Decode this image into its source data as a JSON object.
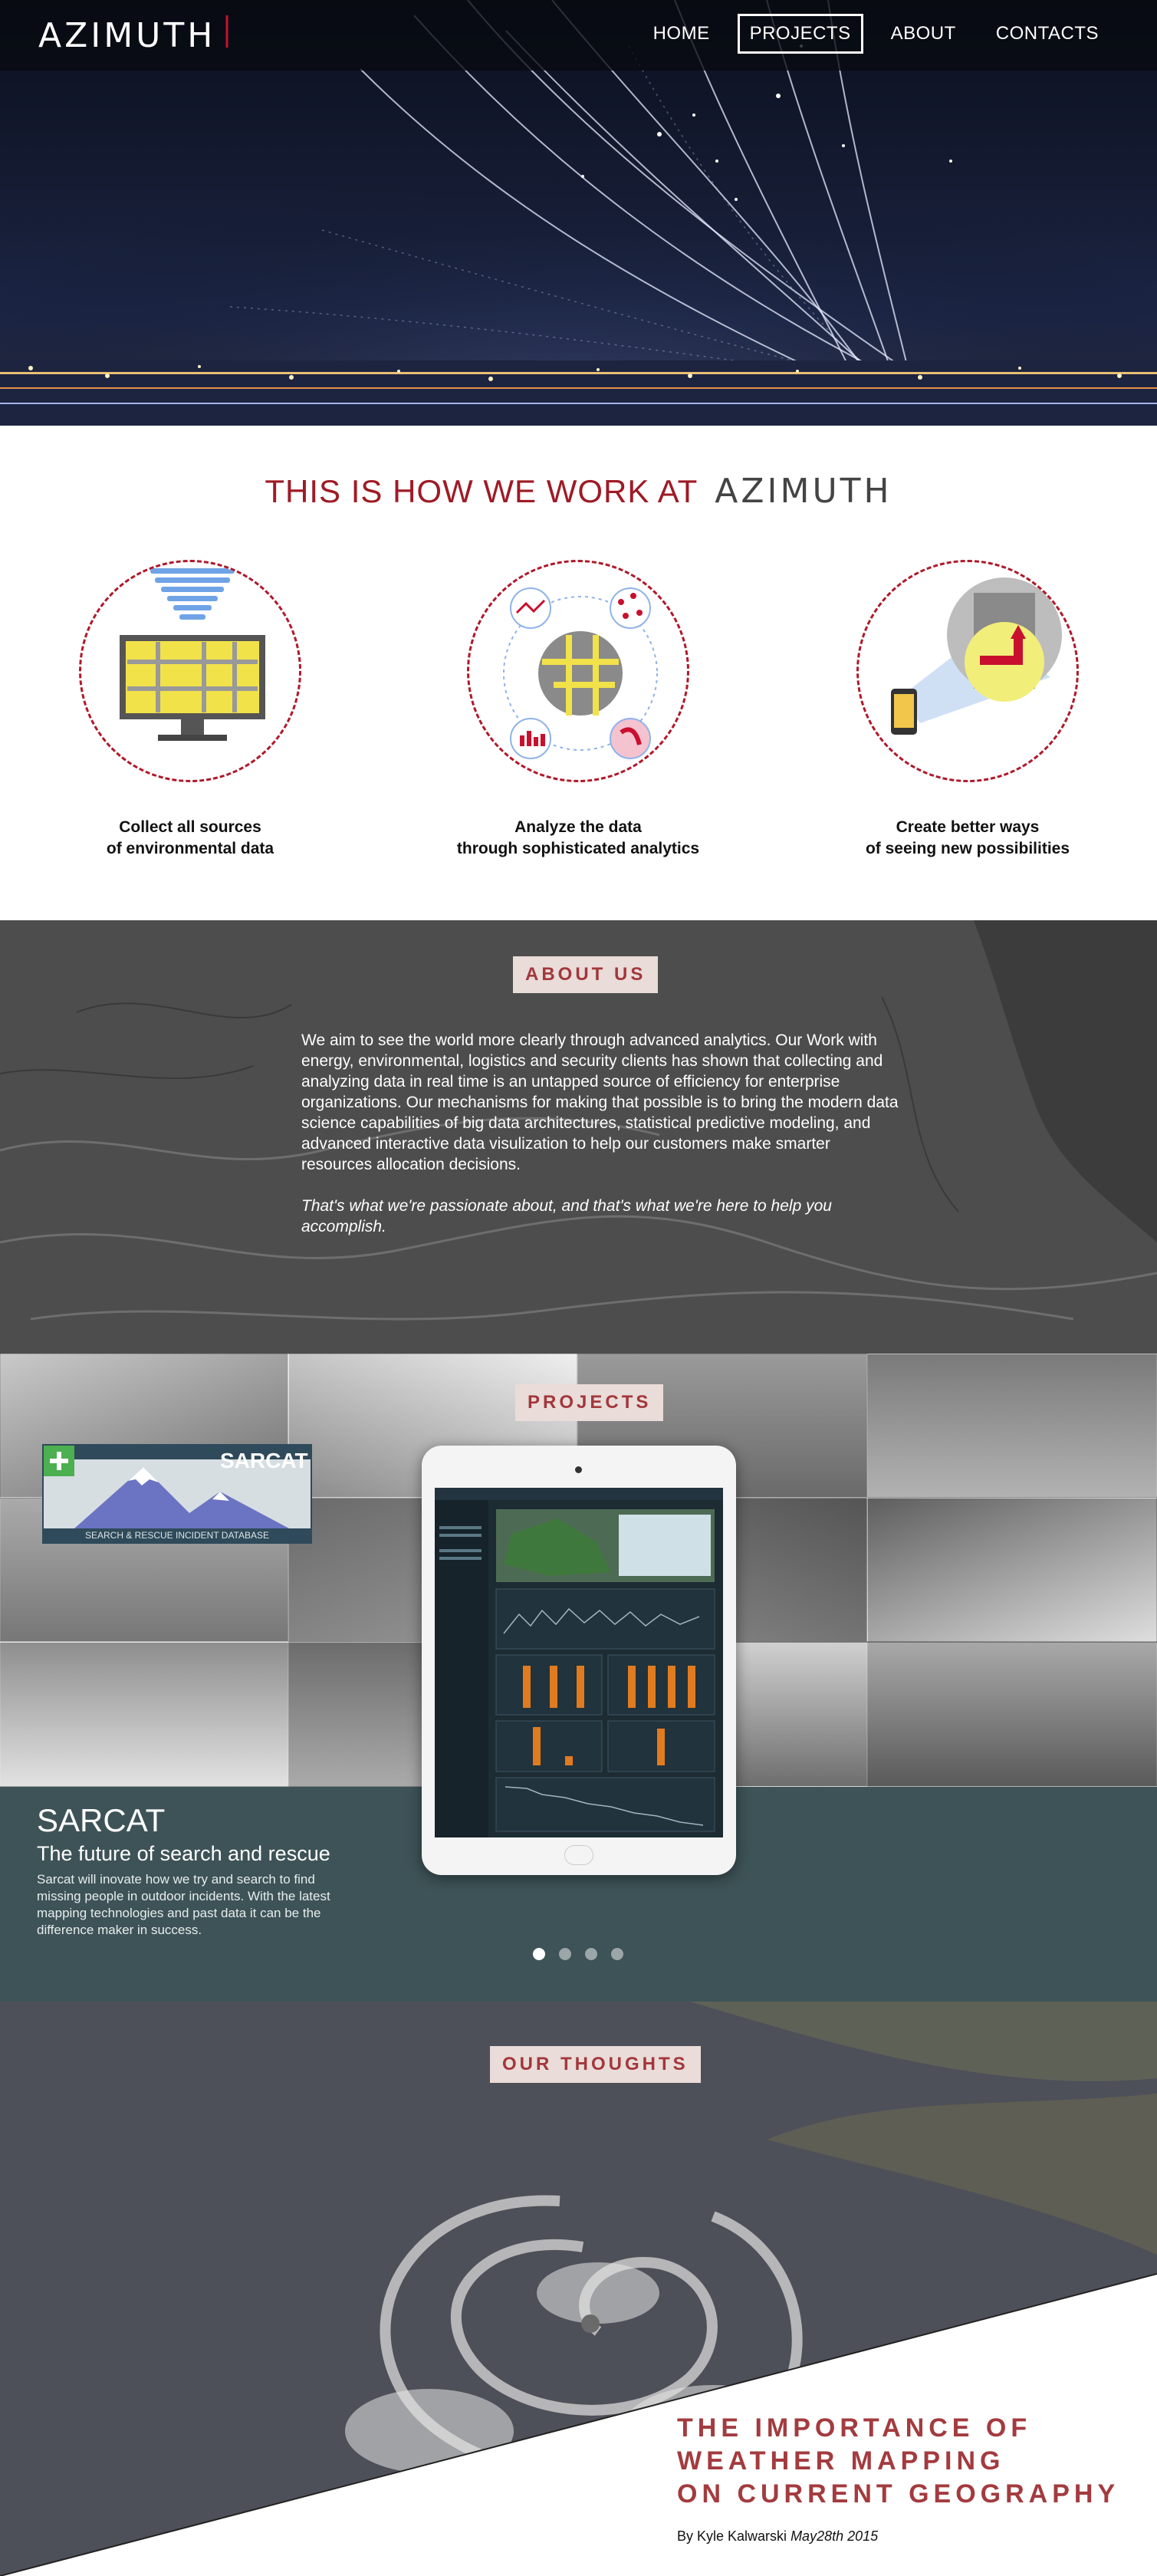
{
  "brand": {
    "logo_text": "AZIMUTH"
  },
  "nav": {
    "items": [
      {
        "label": "HOME"
      },
      {
        "label": "PROJECTS"
      },
      {
        "label": "ABOUT"
      },
      {
        "label": "CONTACTS"
      }
    ],
    "active": "PROJECTS"
  },
  "work": {
    "title": "THIS IS HOW WE WORK AT",
    "logo_text": "AZIMUTH",
    "steps": [
      {
        "line1": "Collect all sources",
        "line2": "of  environmental data"
      },
      {
        "line1": "Analyze the data",
        "line2": "through sophisticated analytics"
      },
      {
        "line1": "Create better ways",
        "line2": "of seeing new possibilities"
      }
    ]
  },
  "about": {
    "tag": "ABOUT US",
    "paragraph": "We aim to see the world more clearly through advanced analytics. Our Work with energy, environmental, logistics and security clients has shown that collecting and analyzing data in real time is an untapped source of efficiency for enterprise organizations. Our mechanisms for making that possible is to bring the modern data science capabilities of big data architectures, statistical predictive modeling, and advanced interactive data visulization to help our customers make smarter resources allocation decisions.",
    "tagline": "That's what we're passionate about, and that's what we're here to help you accomplish."
  },
  "projects": {
    "tag": "PROJECTS",
    "badge_name": "SARCAT",
    "badge_subtitle": "SEARCH & RESCUE INCIDENT DATABASE",
    "title": "SARCAT",
    "subtitle": "The future of search and rescue",
    "description": "Sarcat will inovate how we try and search to find missing people in outdoor incidents. With the latest mapping technologies and past data it can be the difference maker in success.",
    "slides_count": 4,
    "active_slide": 1
  },
  "thoughts": {
    "tag": "OUR THOUGHTS",
    "article_title_lines": [
      "THE IMPORTANCE OF",
      "WEATHER MAPPING",
      "ON CURRENT GEOGRAPHY"
    ],
    "author": "By Kyle Kalwarski",
    "date": "May28th 2015"
  },
  "colors": {
    "brand_red": "#9e1b26",
    "tag_text": "#a3373b",
    "tag_bg": "#e9dcd9",
    "project_panel": "#3e5357"
  }
}
